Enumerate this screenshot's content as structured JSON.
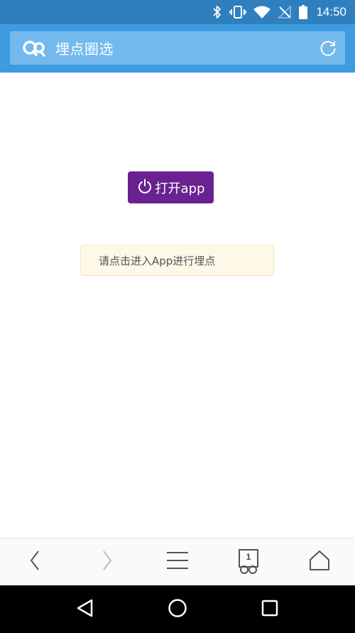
{
  "status_bar": {
    "time": "14:50",
    "icons": [
      "bluetooth-icon",
      "vibrate-icon",
      "wifi-icon",
      "no-signal-icon",
      "battery-icon"
    ]
  },
  "app_bar": {
    "title": "埋点圈选",
    "logo_icon": "glasses-logo-icon",
    "refresh_icon": "refresh-icon",
    "background_color": "#3d9be0",
    "url_bar_color": "#73b9ee"
  },
  "main": {
    "open_app_button_label": "打开app",
    "open_app_button_icon": "power-icon",
    "open_app_button_color": "#6a2290",
    "notice_text": "请点击进入App进行埋点"
  },
  "toolbar": {
    "items": [
      {
        "name": "back",
        "icon": "chevron-left-icon"
      },
      {
        "name": "forward",
        "icon": "chevron-right-icon"
      },
      {
        "name": "menu",
        "icon": "menu-icon"
      },
      {
        "name": "tabs",
        "icon": "tabs-icon",
        "count": "1"
      },
      {
        "name": "home",
        "icon": "home-icon"
      }
    ]
  },
  "nav_bar": {
    "items": [
      "back-triangle-icon",
      "home-circle-icon",
      "recents-square-icon"
    ]
  }
}
